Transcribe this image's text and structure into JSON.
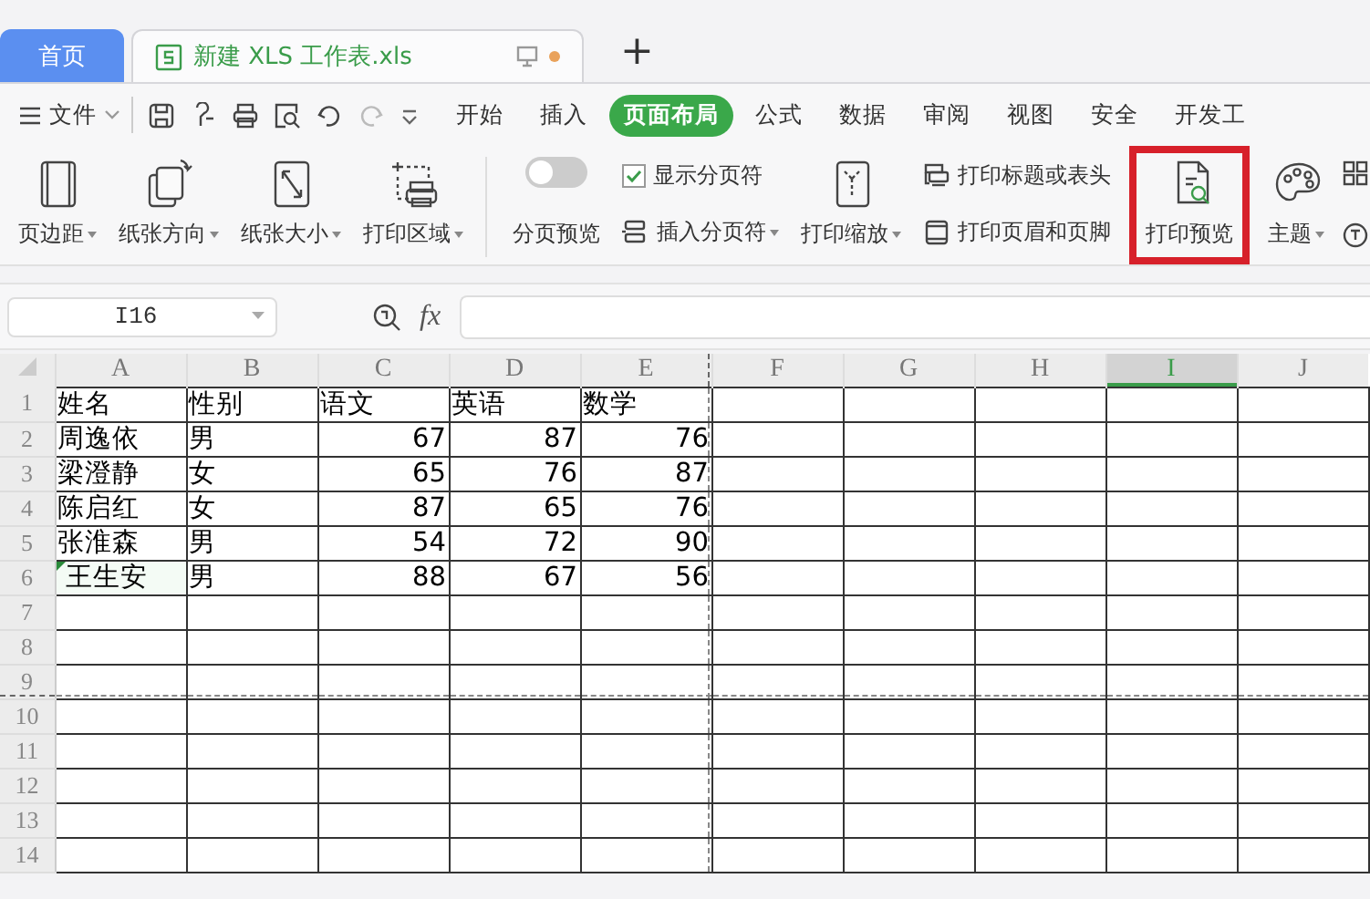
{
  "tabs": [
    {
      "label": "首页",
      "kind": "home",
      "selected": false
    },
    {
      "label": "新建 XLS 工作表.xls",
      "kind": "document",
      "selected": true,
      "unsaved": true
    }
  ],
  "new_tab_label": "+",
  "menu": {
    "file_label": "文件",
    "items": [
      {
        "label": "开始",
        "selected": false
      },
      {
        "label": "插入",
        "selected": false
      },
      {
        "label": "页面布局",
        "selected": true
      },
      {
        "label": "公式",
        "selected": false
      },
      {
        "label": "数据",
        "selected": false
      },
      {
        "label": "审阅",
        "selected": false
      },
      {
        "label": "视图",
        "selected": false
      },
      {
        "label": "安全",
        "selected": false
      },
      {
        "label": "开发工",
        "selected": false
      }
    ]
  },
  "ribbon": {
    "items": [
      {
        "kind": "large",
        "label": "页边距",
        "dropdown": true,
        "highlighted": false
      },
      {
        "kind": "large",
        "label": "纸张方向",
        "dropdown": true,
        "highlighted": false
      },
      {
        "kind": "large",
        "label": "纸张大小",
        "dropdown": true,
        "highlighted": false
      },
      {
        "kind": "large",
        "label": "打印区域",
        "dropdown": true,
        "highlighted": false
      },
      {
        "kind": "separator"
      },
      {
        "kind": "toggle",
        "label": "分页预览",
        "on": false
      },
      {
        "kind": "stack",
        "items": [
          {
            "kind": "check",
            "label": "显示分页符",
            "checked": true
          },
          {
            "kind": "small",
            "label": "插入分页符",
            "dropdown": true
          }
        ]
      },
      {
        "kind": "large",
        "label": "打印缩放",
        "dropdown": true,
        "highlighted": false
      },
      {
        "kind": "stack",
        "items": [
          {
            "kind": "small",
            "label": "打印标题或表头",
            "dropdown": false
          },
          {
            "kind": "small",
            "label": "打印页眉和页脚",
            "dropdown": false
          }
        ]
      },
      {
        "kind": "large",
        "label": "打印预览",
        "dropdown": false,
        "highlighted": true
      },
      {
        "kind": "large",
        "label": "主题",
        "dropdown": true,
        "highlighted": false
      },
      {
        "kind": "cut"
      }
    ]
  },
  "formula_bar": {
    "name_box": "I16",
    "fx_label": "fx"
  },
  "sheet": {
    "columns": [
      {
        "label": "A",
        "kind": "text",
        "selected": false,
        "page_break": false
      },
      {
        "label": "B",
        "kind": "text",
        "selected": false,
        "page_break": false
      },
      {
        "label": "C",
        "kind": "number",
        "selected": false,
        "page_break": false
      },
      {
        "label": "D",
        "kind": "number",
        "selected": false,
        "page_break": false
      },
      {
        "label": "E",
        "kind": "number",
        "selected": false,
        "page_break": true
      },
      {
        "label": "F",
        "kind": "text",
        "selected": false,
        "page_break": false
      },
      {
        "label": "G",
        "kind": "text",
        "selected": false,
        "page_break": false
      },
      {
        "label": "H",
        "kind": "text",
        "selected": false,
        "page_break": false
      },
      {
        "label": "I",
        "kind": "text",
        "selected": true,
        "page_break": false
      },
      {
        "label": "J",
        "kind": "text",
        "selected": false,
        "page_break": false
      }
    ],
    "rows": [
      {
        "label": "1",
        "kind": "header",
        "flagged": false,
        "page_break": false,
        "cells": [
          "姓名",
          "性别",
          "语文",
          "英语",
          "数学"
        ]
      },
      {
        "label": "2",
        "kind": "data",
        "flagged": false,
        "page_break": false,
        "cells": [
          "周逸依",
          "男",
          "67",
          "87",
          "76"
        ]
      },
      {
        "label": "3",
        "kind": "data",
        "flagged": false,
        "page_break": false,
        "cells": [
          "梁澄静",
          "女",
          "65",
          "76",
          "87"
        ]
      },
      {
        "label": "4",
        "kind": "data",
        "flagged": false,
        "page_break": false,
        "cells": [
          "陈启红",
          "女",
          "87",
          "65",
          "76"
        ]
      },
      {
        "label": "5",
        "kind": "data",
        "flagged": false,
        "page_break": false,
        "cells": [
          "张淮森",
          "男",
          "54",
          "72",
          "90"
        ]
      },
      {
        "label": "6",
        "kind": "data",
        "flagged": true,
        "page_break": false,
        "cells": [
          " 王生安",
          "男",
          "88",
          "67",
          "56"
        ]
      },
      {
        "label": "7",
        "kind": "data",
        "flagged": false,
        "page_break": false,
        "cells": []
      },
      {
        "label": "8",
        "kind": "data",
        "flagged": false,
        "page_break": false,
        "cells": []
      },
      {
        "label": "9",
        "kind": "data",
        "flagged": false,
        "page_break": true,
        "cells": []
      },
      {
        "label": "10",
        "kind": "data",
        "flagged": false,
        "page_break": false,
        "cells": []
      },
      {
        "label": "11",
        "kind": "data",
        "flagged": false,
        "page_break": false,
        "cells": []
      },
      {
        "label": "12",
        "kind": "data",
        "flagged": false,
        "page_break": false,
        "cells": []
      },
      {
        "label": "13",
        "kind": "data",
        "flagged": false,
        "page_break": false,
        "cells": []
      },
      {
        "label": "14",
        "kind": "data",
        "flagged": false,
        "page_break": false,
        "cells": []
      }
    ]
  }
}
